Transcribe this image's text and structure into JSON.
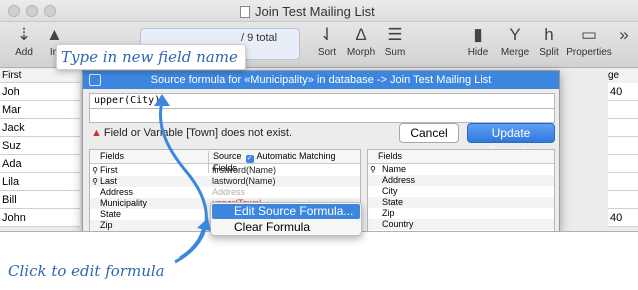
{
  "window": {
    "title": "Join Test Mailing List",
    "status_text": "/ 9 total"
  },
  "toolbar": {
    "add": "Add",
    "in": "In",
    "sort": "Sort",
    "morph": "Morph",
    "sum": "Sum",
    "hide": "Hide",
    "merge": "Merge",
    "split": "Split",
    "properties": "Properties",
    "more": "»"
  },
  "list": {
    "header_left": "First",
    "header_right": "ge",
    "rows": [
      "Joh",
      "Mar",
      "Jack",
      "Suz",
      "Ada",
      "Lila",
      "Bill",
      "John"
    ],
    "right_values": [
      "40",
      "",
      "",
      "",
      "",
      "",
      "",
      "40"
    ]
  },
  "dialog": {
    "title": "Source formula for «Municipality» in database -> Join Test Mailing List",
    "formula": "upper(City)",
    "error": "Field or Variable [Town] does not exist.",
    "cancel": "Cancel",
    "update": "Update Formula",
    "fields_header": "Fields",
    "source_header": "Source",
    "auto_match": "Automatic Matching Fields",
    "target_header": "Fields",
    "rows": [
      {
        "field": "First",
        "source": "firstword(Name)",
        "key": true
      },
      {
        "field": "Last",
        "source": "lastword(Name)",
        "key": true
      },
      {
        "field": "Address",
        "source": "Address",
        "key": false
      },
      {
        "field": "Municipality",
        "source": "upper(Town)",
        "key": false
      },
      {
        "field": "State",
        "source": "",
        "key": false
      },
      {
        "field": "Zip",
        "source": "",
        "key": false
      }
    ],
    "target_rows": [
      {
        "field": "Name",
        "key": true
      },
      {
        "field": "Address",
        "key": false
      },
      {
        "field": "City",
        "key": false
      },
      {
        "field": "State",
        "key": false
      },
      {
        "field": "Zip",
        "key": false
      },
      {
        "field": "Country",
        "key": false
      }
    ]
  },
  "context_menu": {
    "items": [
      "Edit Source Formula...",
      "Clear Formula"
    ]
  },
  "callouts": {
    "top": "Type in new field name",
    "bottom": "Click to edit formula"
  },
  "colors": {
    "accent": "#3d86e0",
    "callout": "#2f66b4",
    "error": "#d0322a"
  }
}
